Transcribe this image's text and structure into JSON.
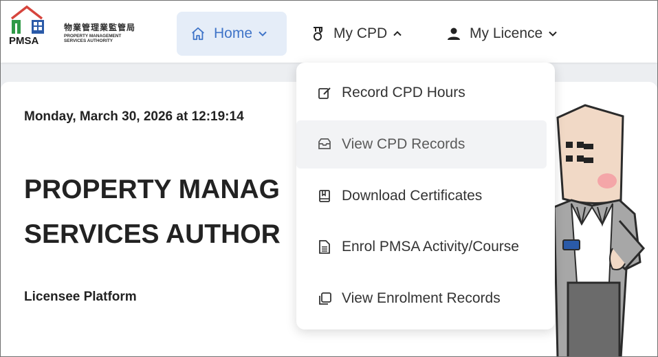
{
  "logo": {
    "chinese": "物業管理業監管局",
    "english_line1": "PROPERTY MANAGEMENT",
    "english_line2": "SERVICES AUTHORITY",
    "abbreviation": "PMSA"
  },
  "nav": {
    "home": {
      "label": "Home",
      "icon": "home-icon"
    },
    "cpd": {
      "label": "My CPD",
      "icon": "medal-icon"
    },
    "licence": {
      "label": "My Licence",
      "icon": "user-icon"
    }
  },
  "content": {
    "datetime": "Monday, March 30, 2026 at 12:19:14",
    "title_line1": "PROPERTY MANAG",
    "title_line2": "SERVICES AUTHOR",
    "subtitle": "Licensee Platform"
  },
  "dropdown": {
    "items": [
      {
        "label": "Record CPD Hours",
        "icon": "edit-icon"
      },
      {
        "label": "View CPD Records",
        "icon": "inbox-icon"
      },
      {
        "label": "Download Certificates",
        "icon": "book-icon"
      },
      {
        "label": "Enrol PMSA Activity/Course",
        "icon": "document-icon"
      },
      {
        "label": "View Enrolment Records",
        "icon": "copy-icon"
      }
    ]
  },
  "colors": {
    "accent": "#3f74c8",
    "highlight_border": "#ff0000",
    "highlight_fill": "#f3f57e"
  }
}
